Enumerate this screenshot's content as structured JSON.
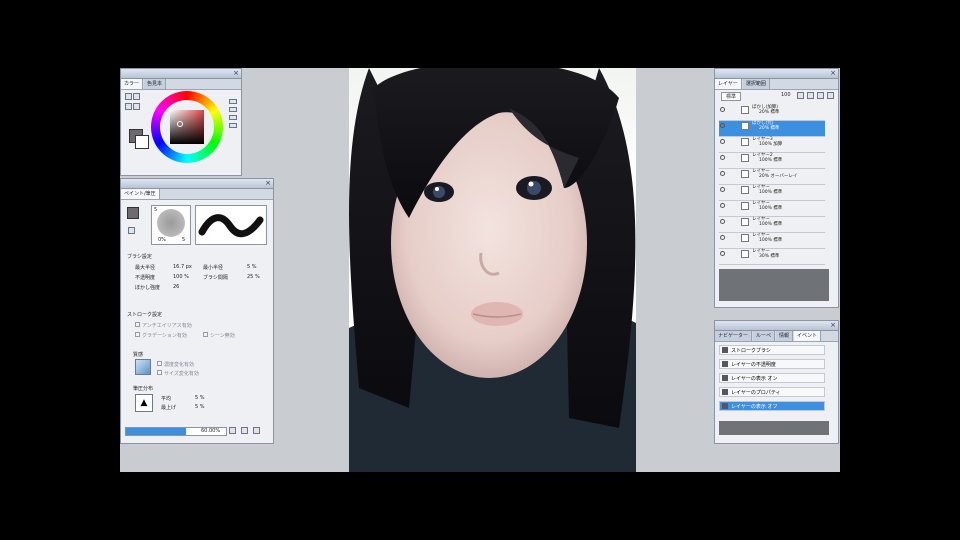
{
  "color_panel": {
    "tabs": [
      "カラー",
      "色見本"
    ],
    "main_color": "#6f6a72",
    "sub_color": "#ffffff"
  },
  "brush_panel": {
    "tabs": [
      "ペイント/筆圧"
    ],
    "tip_size_label": "5",
    "tip_opacity_label": "0%",
    "tip_density_label": "5",
    "sections": {
      "brush_settings": "ブラシ設定",
      "stroke_settings": "ストローク設定",
      "texture": "質感",
      "pressure": "筆圧分布"
    },
    "params": [
      {
        "label": "最大半径",
        "value": "16.7 px"
      },
      {
        "label": "最小半径",
        "value": "5 %"
      },
      {
        "label": "不透明度",
        "value": "100 %"
      },
      {
        "label": "ブラシ間隔",
        "value": "25 %"
      },
      {
        "label": "ぼかし強度",
        "value": "26"
      }
    ],
    "stroke_checks": [
      "アンチエイリアス有効",
      "グラデーション有効",
      "シーン無効"
    ],
    "texture_checks": [
      "濃度変化有効",
      "サイズ変化有効"
    ],
    "pressure_vals": [
      {
        "label": "平均",
        "value": "5 %"
      },
      {
        "label": "最上げ",
        "value": "5 %"
      }
    ],
    "progress": 0.6,
    "progress_text": "60.00%",
    "accent": "#3d8fe0"
  },
  "layer_panel": {
    "tabs": [
      "レイヤー",
      "選択範囲"
    ],
    "blend_mode": "標準",
    "opacity": "100",
    "layers": [
      {
        "name": "ぼかし(加算)",
        "mode": "20% 標準",
        "selected": false
      },
      {
        "name": "ぼかし(元)",
        "mode": "20% 標準",
        "selected": true
      },
      {
        "name": "レイヤー3",
        "mode": "100% 加算",
        "selected": false
      },
      {
        "name": "レイヤー2",
        "mode": "100% 標準",
        "selected": false
      },
      {
        "name": "レイヤー",
        "mode": "20% オーバーレイ",
        "selected": false
      },
      {
        "name": "レイヤー",
        "mode": "100% 標準",
        "selected": false
      },
      {
        "name": "レイヤー",
        "mode": "100% 標準",
        "selected": false
      },
      {
        "name": "レイヤー",
        "mode": "100% 標準",
        "selected": false
      },
      {
        "name": "レイヤー",
        "mode": "100% 標準",
        "selected": false
      },
      {
        "name": "レイヤー",
        "mode": "30% 標準",
        "selected": false
      }
    ]
  },
  "action_panel": {
    "tabs": [
      "ナビゲーター",
      "ルーペ",
      "情報",
      "イベント"
    ],
    "items": [
      {
        "label": "ストロークブラシ",
        "selected": false
      },
      {
        "label": "レイヤーの不透明度",
        "selected": false
      },
      {
        "label": "レイヤーの表示 オン",
        "selected": false
      },
      {
        "label": "レイヤーのプロパティ",
        "selected": false
      },
      {
        "label": "レイヤーの表示 オフ",
        "selected": true
      }
    ]
  }
}
